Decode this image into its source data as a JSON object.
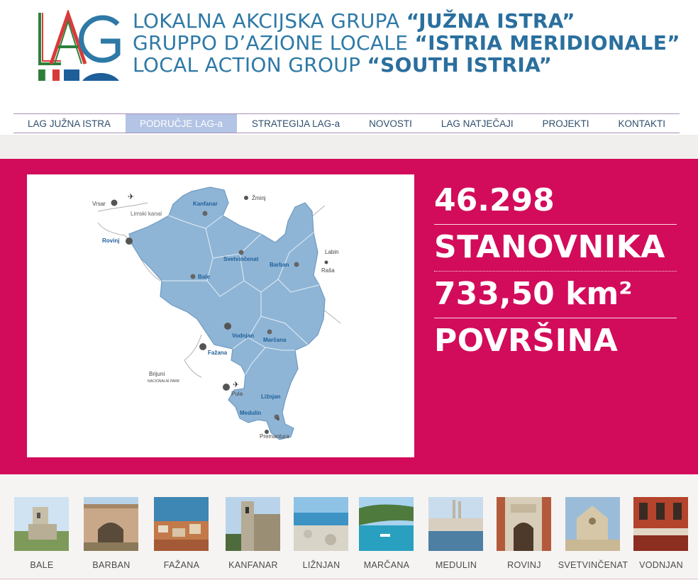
{
  "header": {
    "logo_text": "LAG",
    "lines": [
      {
        "prefix": "LOKALNA AKCIJSKA GRUPA ",
        "name": "“JUŽNA ISTRA”"
      },
      {
        "prefix": "GRUPPO D’AZIONE LOCALE ",
        "name": "“ISTRIA MERIDIONALE”"
      },
      {
        "prefix": "LOCAL ACTION GROUP ",
        "name": "“SOUTH ISTRIA”"
      }
    ]
  },
  "nav": {
    "items": [
      "LAG JUŽNA ISTRA",
      "PODRUČJE LAG-a",
      "STRATEGIJA LAG-a",
      "NOVOSTI",
      "LAG NATJEČAJI",
      "PROJEKTI",
      "KONTAKTI"
    ],
    "active_index": 1
  },
  "stats": {
    "population": "46.298",
    "population_label": "STANOVNIKA",
    "area": "733,50 km²",
    "area_label": "POVRŠINA"
  },
  "map": {
    "labels": [
      "Vrsar",
      "Limski kanal",
      "Kanfanar",
      "Žminj",
      "Rovinj",
      "Svetvinčenat",
      "Labin",
      "Barban",
      "Raša",
      "Bale",
      "Vodnjan",
      "Marčana",
      "Fažana",
      "Brijuni",
      "NACIONALNI PARK",
      "Pula",
      "Ližnjan",
      "Medulin",
      "Premantura",
      "Bale"
    ]
  },
  "thumbnails": [
    {
      "label": "BALE",
      "theme": "tower"
    },
    {
      "label": "BARBAN",
      "theme": "wall"
    },
    {
      "label": "FAŽANA",
      "theme": "harbor"
    },
    {
      "label": "KANFANAR",
      "theme": "belltower"
    },
    {
      "label": "LIŽNJAN",
      "theme": "rocks"
    },
    {
      "label": "MARČANA",
      "theme": "bay"
    },
    {
      "label": "MEDULIN",
      "theme": "town"
    },
    {
      "label": "ROVINJ",
      "theme": "gate"
    },
    {
      "label": "SVETVINČENAT",
      "theme": "church"
    },
    {
      "label": "VODNJAN",
      "theme": "palace"
    }
  ],
  "colors": {
    "band": "#d20c5a",
    "map_fill": "#8fb5d6",
    "title_blue": "#2e79a6",
    "nav_active": "#b3c4e5"
  }
}
